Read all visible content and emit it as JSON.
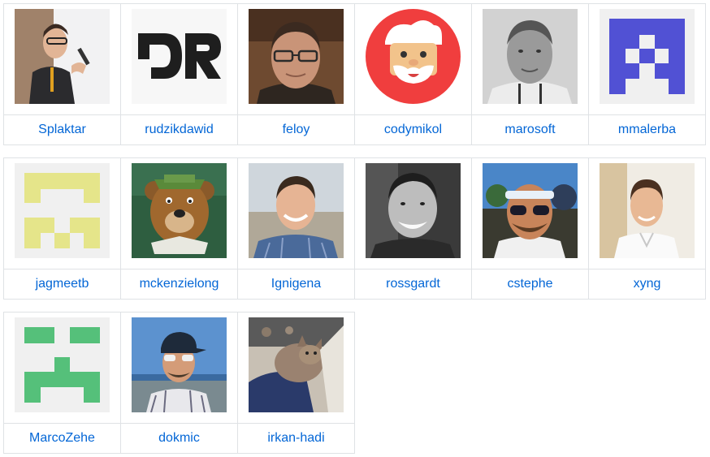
{
  "contributors": [
    [
      {
        "name": "Splaktar",
        "avatar": "photo-speaker-icon"
      },
      {
        "name": "rudzikdawid",
        "avatar": "dr-logo-icon"
      },
      {
        "name": "feloy",
        "avatar": "photo-man-glasses-icon"
      },
      {
        "name": "codymikol",
        "avatar": "santa-face-icon"
      },
      {
        "name": "marosoft",
        "avatar": "photo-man-grayscale-icon"
      },
      {
        "name": "mmalerba",
        "avatar": "identicon-purple-icon"
      }
    ],
    [
      {
        "name": "jagmeetb",
        "avatar": "identicon-yellow-icon"
      },
      {
        "name": "mckenzielong",
        "avatar": "cartoon-bear-icon"
      },
      {
        "name": "Ignigena",
        "avatar": "photo-man-smiling-icon"
      },
      {
        "name": "rossgardt",
        "avatar": "photo-man-bw-icon"
      },
      {
        "name": "cstephe",
        "avatar": "photo-man-sunglasses-icon"
      },
      {
        "name": "xyng",
        "avatar": "photo-man-shirt-icon"
      }
    ],
    [
      {
        "name": "MarcoZehe",
        "avatar": "identicon-green-icon"
      },
      {
        "name": "dokmic",
        "avatar": "photo-man-cap-icon"
      },
      {
        "name": "irkan-hadi",
        "avatar": "photo-cat-icon"
      }
    ]
  ],
  "colors": {
    "link": "#0366d6",
    "border": "#dfe2e5",
    "identicon_purple": "#5151d4",
    "identicon_yellow": "#e5e58a",
    "identicon_green": "#55c07a",
    "santa_red": "#f03e3e"
  }
}
